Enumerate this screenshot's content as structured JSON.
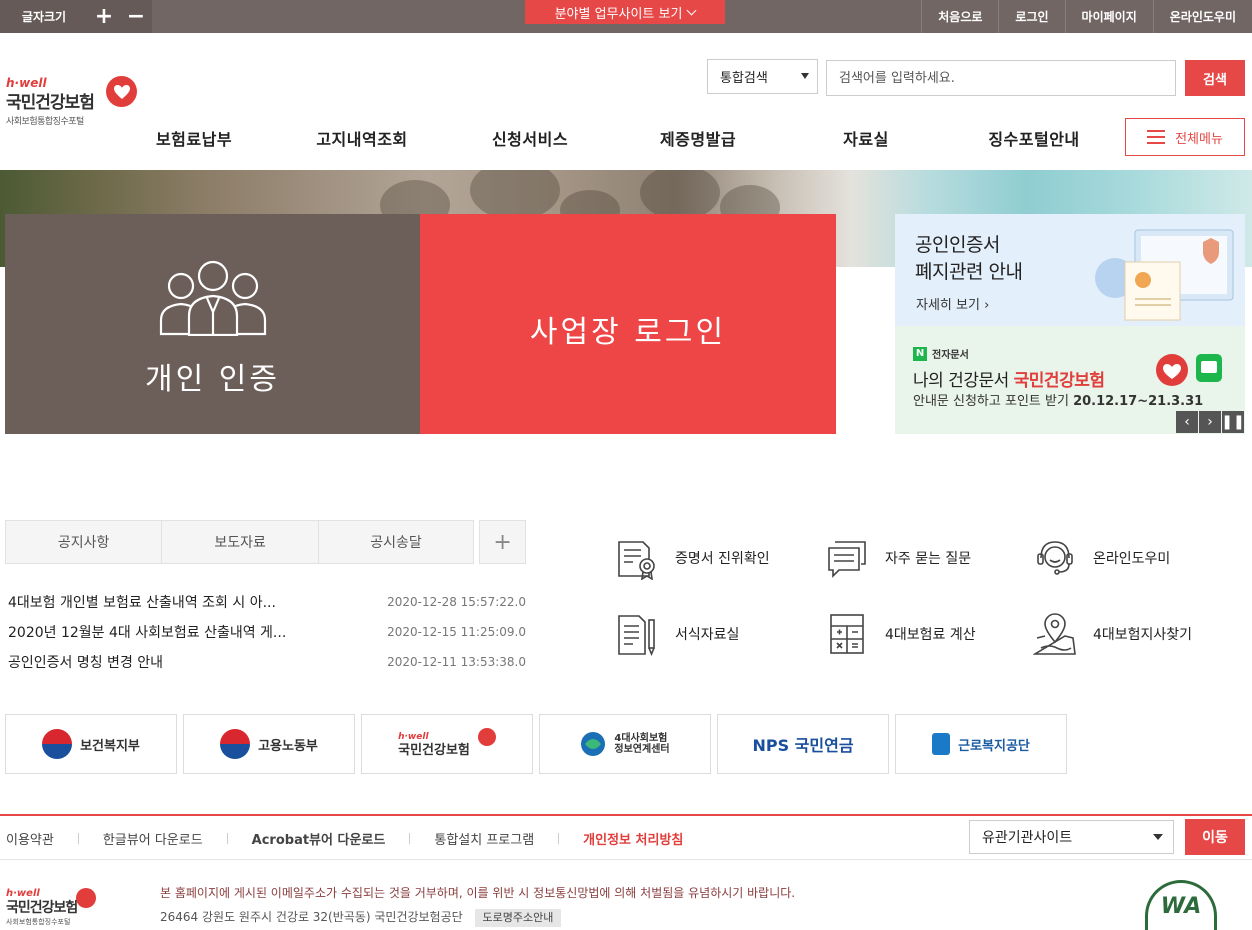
{
  "topbar": {
    "font_size_label": "글자크기",
    "font_plus": "+",
    "font_minus": "−",
    "site_button": "분야별 업무사이트 보기",
    "links": [
      "처음으로",
      "로그인",
      "마이페이지",
      "온라인도우미"
    ]
  },
  "header": {
    "logo_hwell": "h·well",
    "logo_name": "국민건강보험",
    "logo_sub": "사회보험통합징수포털",
    "search_scope": "통합검색",
    "search_placeholder": "검색어를 입력하세요.",
    "search_button": "검색",
    "gnb": [
      "보험료납부",
      "고지내역조회",
      "신청서비스",
      "제증명발급",
      "자료실",
      "징수포털안내"
    ],
    "all_menu": "전체메뉴"
  },
  "hero": {
    "personal_label": "개인 인증",
    "business_label": "사업장 로그인",
    "banner1_line1": "공인인증서",
    "banner1_line2": "폐지관련 안내",
    "banner1_more": "자세히 보기",
    "banner2_tag_n": "N",
    "banner2_tag": "전자문서",
    "banner2_line1_a": "나의 건강문서",
    "banner2_line1_b": "국민건강보험",
    "banner2_line2": "안내문 신청하고 포인트 받기",
    "banner2_date": "20.12.17~21.3.31"
  },
  "notice": {
    "tabs": [
      "공지사항",
      "보도자료",
      "공시송달"
    ],
    "plus": "+",
    "items": [
      {
        "title": "4대보험 개인별 보험료 산출내역 조회 시 아...",
        "date": "2020-12-28 15:57:22.0"
      },
      {
        "title": "2020년 12월분 4대 사회보험료 산출내역 게...",
        "date": "2020-12-15 11:25:09.0"
      },
      {
        "title": "공인인증서 명칭 변경 안내",
        "date": "2020-12-11 13:53:38.0"
      }
    ]
  },
  "quick": [
    "증명서 진위확인",
    "자주 묻는 질문",
    "온라인도우미",
    "서식자료실",
    "4대보험료 계산",
    "4대보험지사찾기"
  ],
  "orgs": {
    "mohw": "보건복지부",
    "moel": "고용노동부",
    "nhis_hwell": "h·well",
    "nhis": "국민건강보험",
    "center_line1": "4대사회보험",
    "center_line2": "정보연계센터",
    "nps": "NPS 국민연금",
    "kcomwel": "근로복지공단"
  },
  "footer": {
    "links": [
      "이용약관",
      "한글뷰어 다운로드",
      "Acrobat뷰어 다운로드",
      "통합설치 프로그램",
      "개인정보 처리방침"
    ],
    "related_sites": "유관기관사이트",
    "go_button": "이동",
    "logo_hwell": "h·well",
    "logo_name": "국민건강보험",
    "logo_sub": "사회보험통합징수포털",
    "email_notice": "본 홈페이지에 게시된 이메일주소가 수집되는 것을 거부하며, 이를 위반 시 정보통신망법에 의해 처벌됨을 유념하시기 바랍니다.",
    "address": "26464 강원도 원주시 건강로 32(반곡동) 국민건강보험공단",
    "road_address": "도로명주소안내",
    "wa_mark": "WA"
  },
  "colors": {
    "accent": "#e54847",
    "topbar": "#716664",
    "personal_tile": "#6c5e59"
  }
}
